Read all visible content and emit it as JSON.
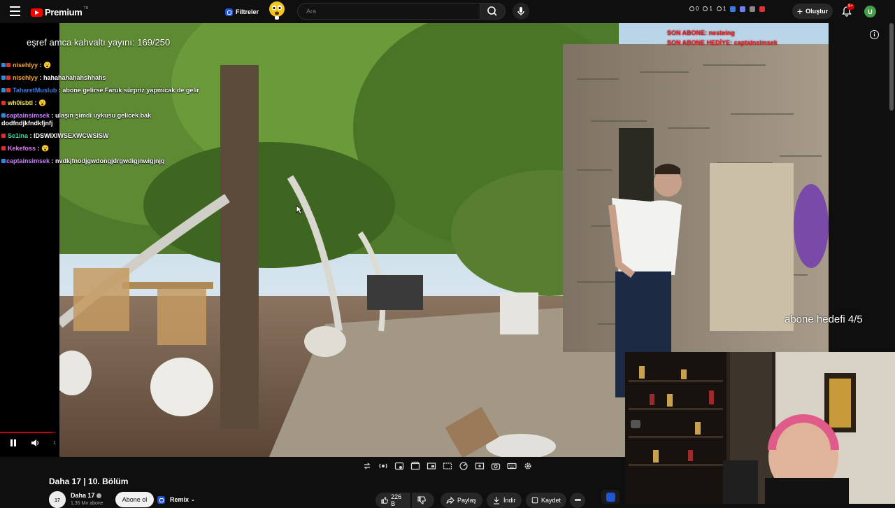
{
  "topbar": {
    "logo_text": "Premium",
    "logo_region": "TR",
    "filters_label": "Filtreler",
    "search_placeholder": "Ara",
    "status_counts": [
      "0",
      "1",
      "1"
    ],
    "create_label": "Oluştur",
    "notification_count": "9+",
    "avatar_letter": "U"
  },
  "overlay": {
    "breakfast_goal": "eşref amca kahvaltı yayını: 169/250",
    "subscriber_goal": "abone hedefi 4/5",
    "sub_ticker": [
      {
        "label": "SON ABONE:",
        "value": "nesteing"
      },
      {
        "label": "SON ABONE HEDİYE:",
        "value": "captainsimsek"
      }
    ]
  },
  "chat": [
    {
      "user": "nisehlyy",
      "color": "#f2a43a",
      "text": " : 😮"
    },
    {
      "user": "nisehlyy",
      "color": "#f2a43a",
      "text": " : hahahahahahshhahs"
    },
    {
      "user": "TaharetMuslub",
      "color": "#3a7be0",
      "text": " : abone gelirse Faruk sürpriz yapmicak de gelir"
    },
    {
      "user": "wh0isbtl",
      "color": "#f5e74a",
      "text": " : 😮"
    },
    {
      "user": "captainsimsek",
      "color": "#c77dff",
      "text": " : ulaşın şimdi uykusu gelicek bak dodfndjkfndkfjnfj"
    },
    {
      "user": "Se1ina",
      "color": "#4ad0a0",
      "text": " : IDSWIXIWSEXWCWSISW"
    },
    {
      "user": "Kekefoss",
      "color": "#e07bf2",
      "text": " : 😮"
    },
    {
      "user": "captainsimsek",
      "color": "#c77dff",
      "text": " : nvdkjfnodjgwdongjdrgwdigjnwigjnjg"
    }
  ],
  "player": {
    "time_fragment": "1"
  },
  "video": {
    "title": "Daha 17 | 10. Bölüm",
    "channel_name": "Daha 17",
    "channel_subs": "1,35 Mn abone",
    "subscribe_label": "Abone ol",
    "remix_label": "Remix",
    "like_count": "226 B",
    "share_label": "Paylaş",
    "download_label": "İndir",
    "save_label": "Kaydet"
  },
  "colors": {
    "accent_red": "#ff0000",
    "extension_blue": "#1e56d6",
    "ticker_red": "#e02020"
  }
}
